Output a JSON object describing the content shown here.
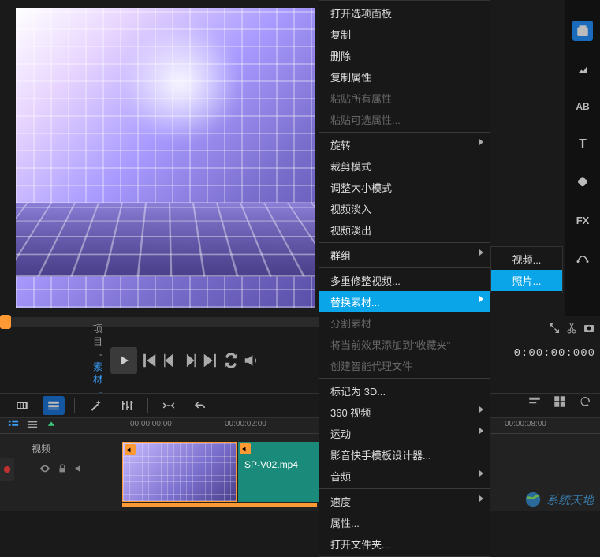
{
  "project_labels": {
    "project": "项目",
    "material": "素材"
  },
  "timecode": "0:00:00:000",
  "context_menu": {
    "open_options": "打开选项面板",
    "copy": "复制",
    "delete": "删除",
    "copy_attrs": "复制属性",
    "paste_all_attrs": "粘贴所有属性",
    "paste_sel_attrs": "粘贴可选属性...",
    "rotate": "旋转",
    "crop_mode": "裁剪模式",
    "resize_mode": "调整大小模式",
    "video_fade_in": "视频淡入",
    "video_fade_out": "视频淡出",
    "group": "群组",
    "multi_trim": "多重修整视频...",
    "replace_material": "替换素材...",
    "split_material": "分割素材",
    "add_fx_fav": "将当前效果添加到\"收藏夹\"",
    "create_proxy": "创建智能代理文件",
    "mark_3d": "标记为 3D...",
    "video_360": "360 视频",
    "motion": "运动",
    "template_designer": "影音快手模板设计器...",
    "audio": "音频",
    "speed": "速度",
    "properties": "属性...",
    "open_folder": "打开文件夹..."
  },
  "submenu": {
    "video": "视频...",
    "photo": "照片..."
  },
  "timeline": {
    "tick0": "00:00:00:00",
    "tick1": "00:00:02:00",
    "tick2": "00:00:08:00",
    "track_label": "视频",
    "clip2_name": "SP-V02.mp4"
  },
  "right_labels": {
    "ab": "AB",
    "t": "T",
    "fx": "FX"
  },
  "watermark": "系统天地"
}
